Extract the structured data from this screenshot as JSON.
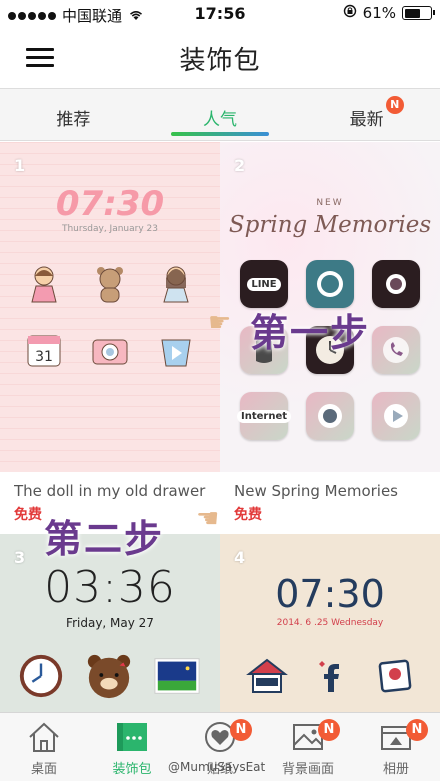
{
  "status_bar": {
    "carrier": "中国联通",
    "time": "17:56",
    "battery": "61%",
    "battery_level": 0.61
  },
  "header": {
    "title": "装饰包"
  },
  "tabs": [
    {
      "label": "推荐",
      "active": false,
      "badge": ""
    },
    {
      "label": "人气",
      "active": true,
      "badge": ""
    },
    {
      "label": "最新",
      "active": false,
      "badge": "N"
    }
  ],
  "themes": [
    {
      "index": "1",
      "clock": "07:30",
      "date": "Thursday, January 23",
      "name": "The doll in my old drawer",
      "price": "免费"
    },
    {
      "index": "2",
      "subtitle": "NEW",
      "title_art": "Spring Memories",
      "name": "New Spring Memories",
      "price": "免费",
      "icons": [
        "LINE",
        "Internet"
      ]
    },
    {
      "index": "3",
      "clock": "03:36",
      "date": "Friday, May 27"
    },
    {
      "index": "4",
      "clock": "07:30",
      "date": "2014. 6 .25  Wednesday"
    }
  ],
  "annotations": {
    "step1": "第一步",
    "step2": "第二步"
  },
  "bottom_nav": [
    {
      "label": "桌面",
      "icon": "home-icon",
      "active": false,
      "badge": ""
    },
    {
      "label": "装饰包",
      "icon": "theme-pack-icon",
      "active": true,
      "badge": ""
    },
    {
      "label": "贴纸",
      "icon": "heart-icon",
      "active": false,
      "badge": "N"
    },
    {
      "label": "背景画面",
      "icon": "wallpaper-icon",
      "active": false,
      "badge": "N"
    },
    {
      "label": "相册",
      "icon": "album-icon",
      "active": false,
      "badge": "N"
    }
  ],
  "watermark": "@MumuSaysEat",
  "colors": {
    "accent": "#2bb56d",
    "badge": "#f25b35",
    "price": "#e23b3b"
  }
}
